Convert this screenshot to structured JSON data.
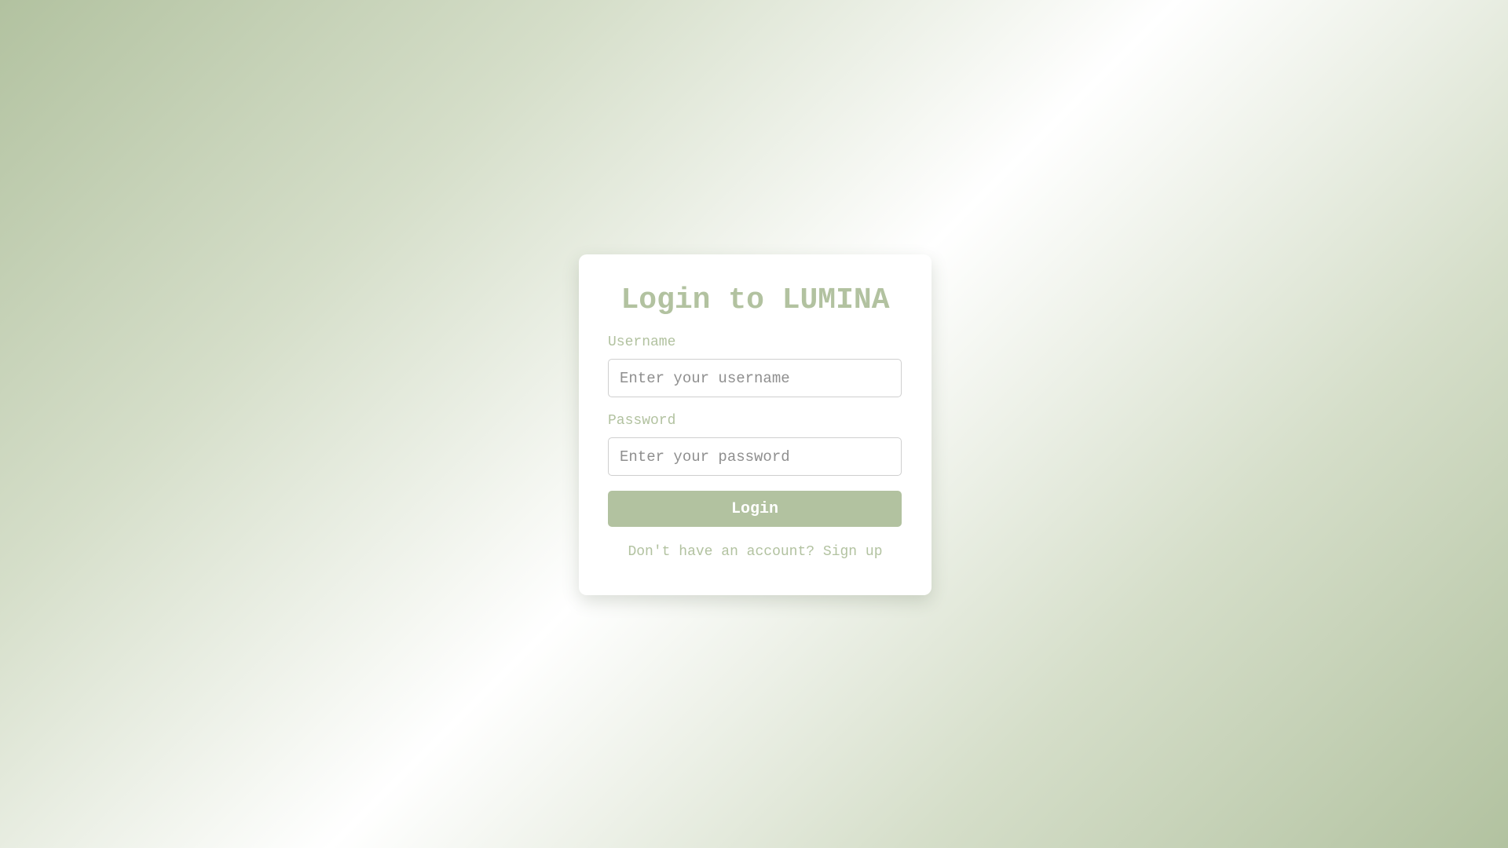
{
  "login_card": {
    "title": "Login to LUMINA",
    "username": {
      "label": "Username",
      "placeholder": "Enter your username",
      "value": ""
    },
    "password": {
      "label": "Password",
      "placeholder": "Enter your password",
      "value": ""
    },
    "login_button_label": "Login",
    "signup_prompt": "Don't have an account?",
    "signup_link_label": "Sign up"
  },
  "colors": {
    "accent": "#b2c2a0",
    "card_background": "#ffffff",
    "input_border": "#cfcfcf",
    "placeholder_text": "#8f8f8f"
  }
}
